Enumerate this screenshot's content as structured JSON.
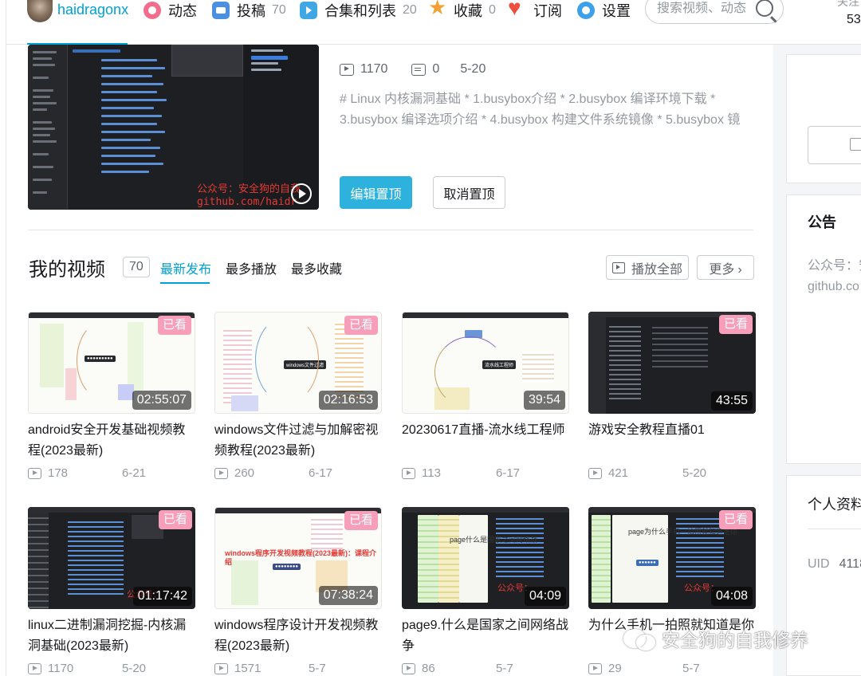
{
  "nav": {
    "username": "haidragonx",
    "items": [
      {
        "label": "动态",
        "count": ""
      },
      {
        "label": "投稿",
        "count": "70"
      },
      {
        "label": "合集和列表",
        "count": "20"
      },
      {
        "label": "收藏",
        "count": "0"
      },
      {
        "label": "订阅",
        "count": ""
      },
      {
        "label": "设置",
        "count": ""
      }
    ],
    "search_placeholder": "搜索视频、动态",
    "right_label": "关注",
    "right_count": "53"
  },
  "pinned": {
    "views": "1170",
    "danmaku": "0",
    "date": "5-20",
    "description": "# Linux 内核漏洞基础 * 1.busybox介绍 * 2.busybox 编译环境下载 * 3.busybox 编译选项介绍 * 4.busybox 构建文件系统镜像 * 5.busybox 镜",
    "thumb_watermark_line1": "公众号：安全狗的自我",
    "thumb_watermark_line2": "github.com/haidr",
    "edit_button": "编辑置顶",
    "cancel_button": "取消置顶"
  },
  "videos_section": {
    "title": "我的视频",
    "count": "70",
    "tabs": [
      "最新发布",
      "最多播放",
      "最多收藏"
    ],
    "play_all": "播放全部",
    "more": "更多"
  },
  "videos": [
    {
      "title": "android安全开发基础视频教程(2023最新)",
      "duration": "02:55:07",
      "badge": "已看",
      "views": "178",
      "date": "6-21",
      "style": "mind"
    },
    {
      "title": "windows文件过滤与加解密视频教程(2023最新)",
      "duration": "02:16:53",
      "badge": "已看",
      "views": "260",
      "date": "6-17",
      "style": "mind"
    },
    {
      "title": "20230617直播-流水线工程师",
      "duration": "39:54",
      "badge": "",
      "views": "113",
      "date": "6-17",
      "style": "mind"
    },
    {
      "title": "游戏安全教程直播01",
      "duration": "43:55",
      "badge": "已看",
      "views": "421",
      "date": "5-20",
      "style": "ide"
    },
    {
      "title": "linux二进制漏洞挖掘-内核漏洞基础(2023最新)",
      "duration": "01:17:42",
      "badge": "已看",
      "views": "1170",
      "date": "5-20",
      "style": "ide"
    },
    {
      "title": "windows程序设计开发视频教程(2023最新)",
      "duration": "07:38:24",
      "badge": "已看",
      "views": "1571",
      "date": "5-7",
      "style": "mind"
    },
    {
      "title": "page9.什么是国家之间网络战争",
      "duration": "04:09",
      "badge": "",
      "views": "86",
      "date": "5-7",
      "style": "ide"
    },
    {
      "title": "为什么手机一拍照就知道是你",
      "duration": "04:08",
      "badge": "已看",
      "views": "29",
      "date": "5-7",
      "style": "ide"
    }
  ],
  "thumb_texts": {
    "t2_center": "windows文件过滤",
    "t3_center": "流水线工程师",
    "t5_red": "公众号：",
    "t6_banner": "windows程序开发视频教程(2023最新)：课程介绍",
    "t7_mid": "page什么是国家之间网络战",
    "t7_red": "公众号：",
    "t8_mid": "page为什么手机一拍照就知道是你",
    "t8_red": "公众号："
  },
  "sidebar": {
    "notice_title": "公告",
    "notice_line1": "公众号：安",
    "notice_line2": "github.co",
    "profile_title": "个人资料",
    "uid_label": "UID",
    "uid_value": "4118"
  },
  "watermark": "安全狗的自我修养"
}
